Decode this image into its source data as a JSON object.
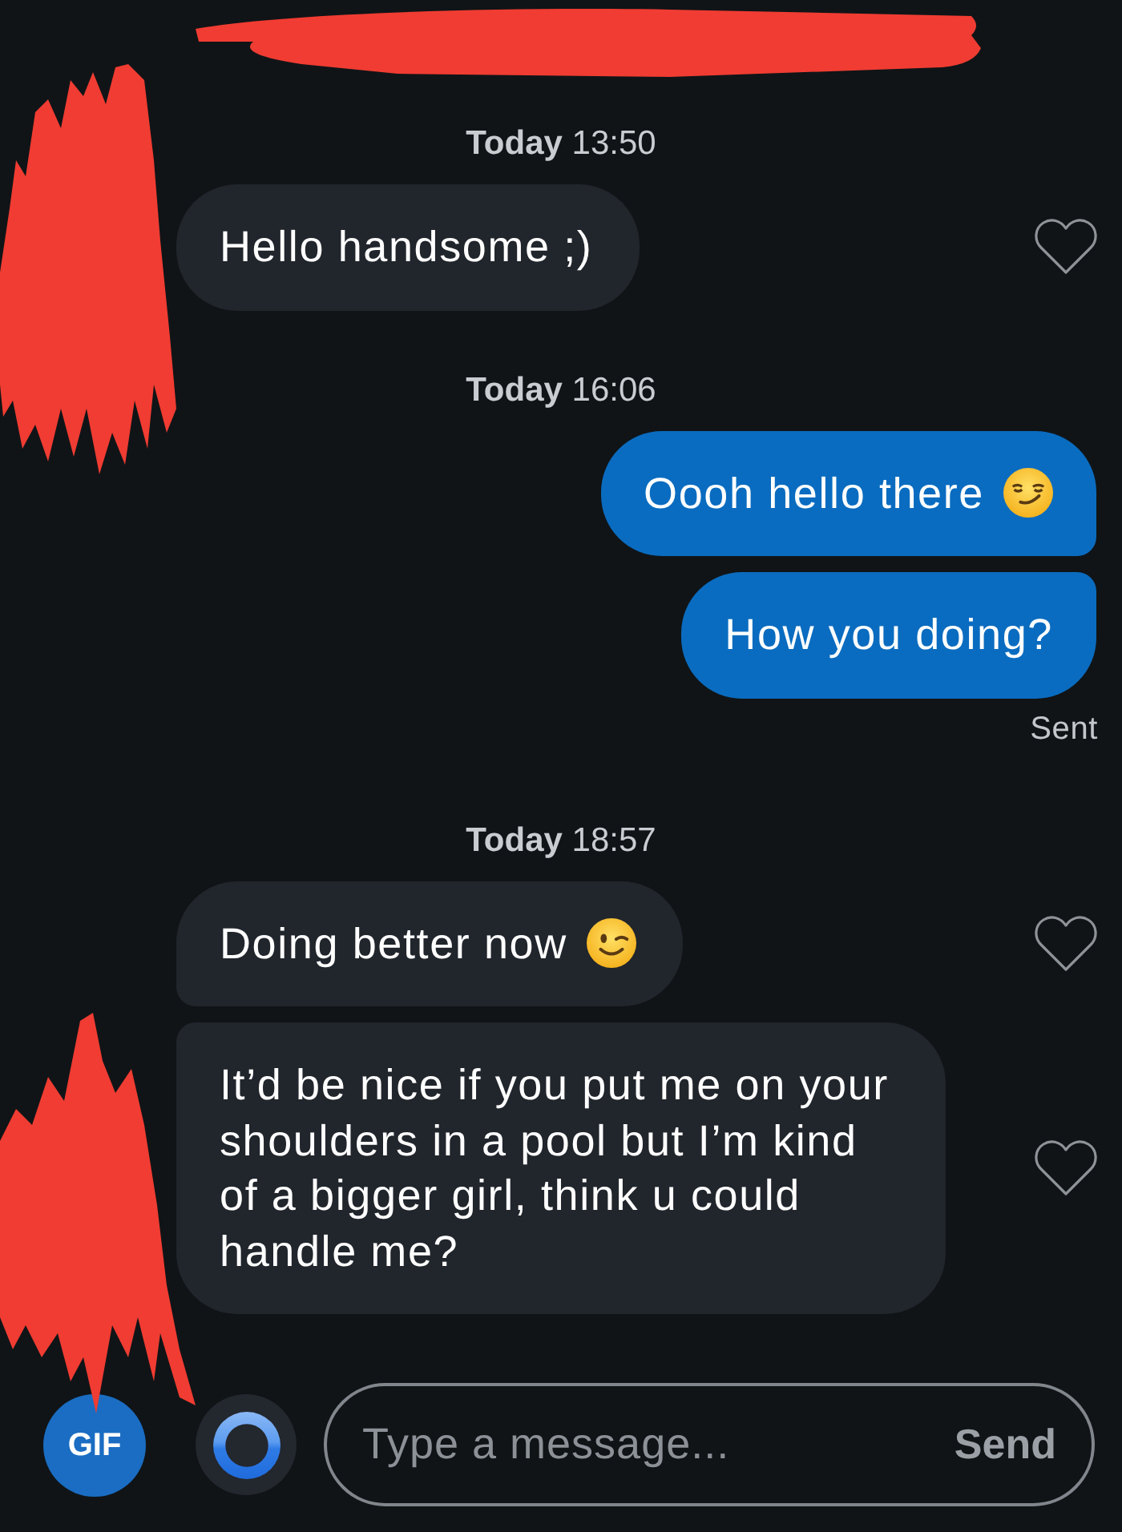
{
  "conversation": [
    {
      "kind": "timestamp",
      "text": "**Today** 13:50"
    },
    {
      "kind": "received",
      "text": "Hello handsome ;)",
      "liked": false
    },
    {
      "kind": "timestamp",
      "text": "**Today** 16:06"
    },
    {
      "kind": "sent",
      "text": "Oooh hello there",
      "emoji": {
        "kind": "smirking"
      }
    },
    {
      "kind": "sent",
      "text": "How you doing?"
    },
    {
      "kind": "receipt",
      "text": "Sent"
    },
    {
      "kind": "timestamp",
      "text": "**Today** 18:57"
    },
    {
      "kind": "received",
      "text": "Doing better now",
      "emoji": {
        "kind": "winking"
      },
      "liked": false
    },
    {
      "kind": "received",
      "text": "It’d be nice if you put me on your shoulders in a pool but I’m kind of a bigger girl, think u could handle me?",
      "liked": false
    }
  ],
  "composer": {
    "gif_button": "GIF",
    "placeholder": "Type a message...",
    "send_button": "Send"
  }
}
